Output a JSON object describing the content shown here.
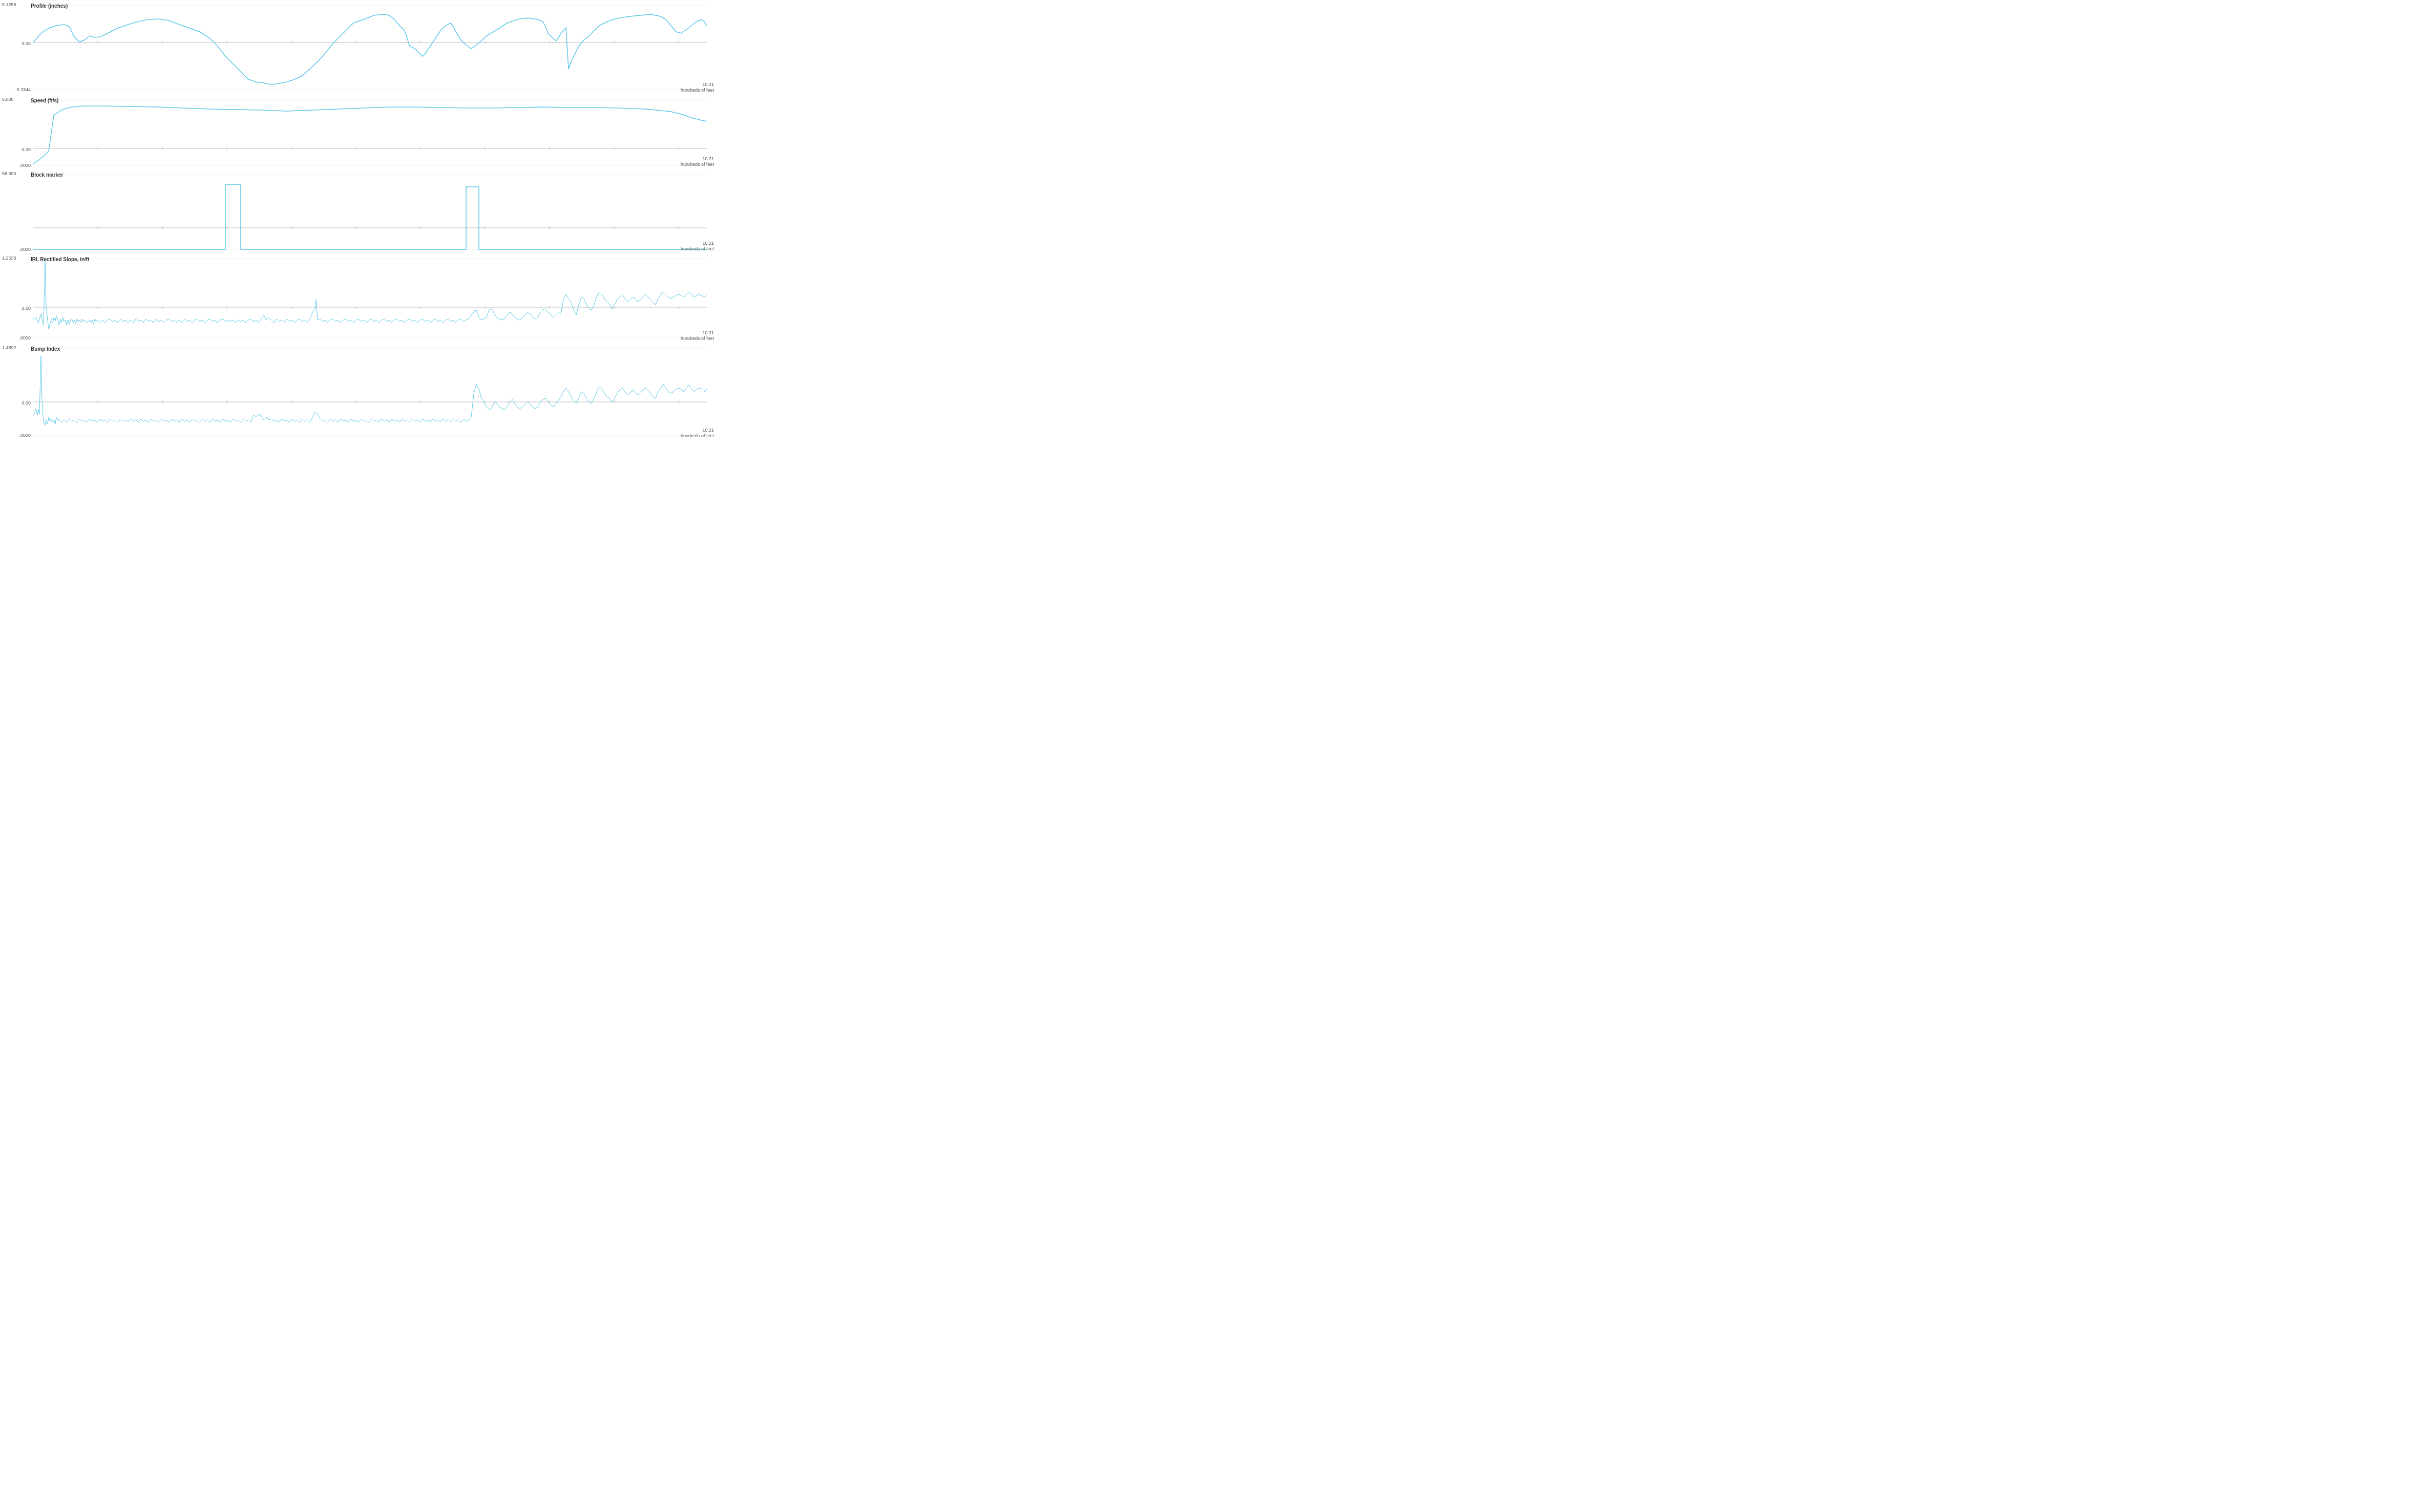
{
  "charts": [
    {
      "id": "profile",
      "title": "Profile (inches)",
      "y_max": "6.1258",
      "y_zero": "0.00",
      "y_min": "-9.2344",
      "x_max": "10.21",
      "x_unit": "hundreds of feet",
      "height": 180
    },
    {
      "id": "speed",
      "title": "Speed (ft/s)",
      "y_max": "6.000",
      "y_zero": "0.00",
      "y_min": ".0000",
      "x_max": "10.21",
      "x_unit": "hundreds of feet",
      "height": 130
    },
    {
      "id": "block_marker",
      "title": "Block marker",
      "y_max": "58.000",
      "y_zero": "",
      "y_min": ".0000",
      "x_max": "10.21",
      "x_unit": "hundreds of feet",
      "height": 150
    },
    {
      "id": "iri",
      "title": "IRI, Rectified Slope, in/ft",
      "y_max": "1.2538",
      "y_zero": "0.00",
      "y_min": ".0000",
      "x_max": "10.21",
      "x_unit": "hundreds of feet",
      "height": 160
    },
    {
      "id": "bump",
      "title": "Bump Index",
      "y_max": "1.4892",
      "y_zero": "0.00",
      "y_min": ".0000",
      "x_max": "10.21",
      "x_unit": "hundreds of feet",
      "height": 180
    }
  ]
}
